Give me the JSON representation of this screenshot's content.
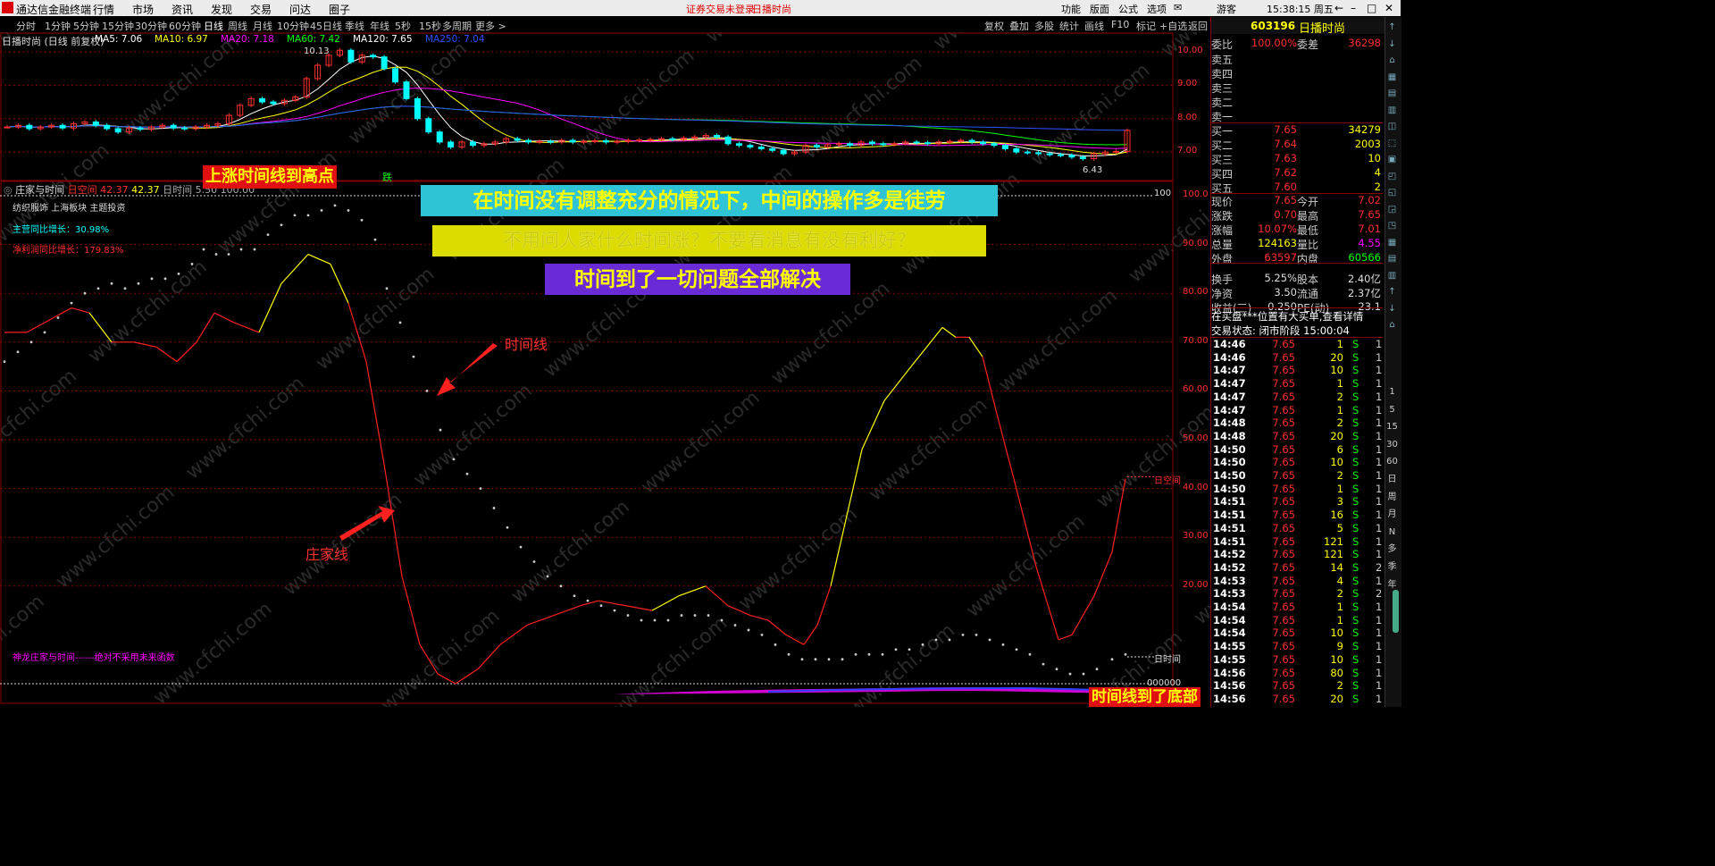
{
  "app": {
    "title": "通达信金融终端",
    "menu": [
      "行情",
      "市场",
      "资讯",
      "发现",
      "交易",
      "问达",
      "圈子"
    ],
    "status": "证券交易未登录",
    "stock_name_title": "日播时尚",
    "right_menu": [
      "功能",
      "版面",
      "公式",
      "选项"
    ],
    "user": "游客",
    "clock": "15:38:15 周五"
  },
  "periods": [
    "分时",
    "1分钟",
    "5分钟",
    "15分钟",
    "30分钟",
    "60分钟",
    "日线",
    "周线",
    "月线",
    "10分钟",
    "45日线",
    "季线",
    "年线",
    "5秒",
    "15秒",
    "多周期",
    "更多 >"
  ],
  "active_period": "日线",
  "toolbar_right": [
    "复权",
    "叠加",
    "多股",
    "统计",
    "画线",
    "F10",
    "标记",
    "+自选",
    "返回"
  ],
  "price_chart": {
    "header": "日播时尚 (日线 前复权)",
    "ma": [
      {
        "label": "MA5: 7.06",
        "color": "#ffffff"
      },
      {
        "label": "MA10: 6.97",
        "color": "#ffff00"
      },
      {
        "label": "MA20: 7.18",
        "color": "#ff00ff"
      },
      {
        "label": "MA60: 7.42",
        "color": "#00ff00"
      },
      {
        "label": "MA120: 7.65",
        "color": "#ffffff"
      },
      {
        "label": "MA250: 7.04",
        "color": "#3050ff"
      }
    ],
    "axis": [
      "10.00",
      "9.00",
      "8.00",
      "7.00"
    ],
    "high_label": "10.13",
    "low_label": "6.43",
    "down_mark": "跌"
  },
  "indicator": {
    "name": "庄家与时间",
    "v1_label": "日空间",
    "v1": "42.37",
    "v2": "42.37",
    "v3_label": "日时间",
    "v3": "5.50",
    "v4": "100.00",
    "info1": "纺织服饰 上海板块 主题投资",
    "info2": "主营同比增长：30.98%",
    "info3": "净利润同比增长：179.83%",
    "bottom_note": "神龙庄家与时间------绝对不采用未来函数",
    "axis": [
      "100.0",
      "90.00",
      "80.00",
      "70.00",
      "60.00",
      "50.00",
      "40.00",
      "30.00",
      "20.00"
    ],
    "right_tag1": "日空间",
    "right_tag2": "日时间",
    "zero_label": "000000",
    "top_label": "100"
  },
  "annotations": {
    "banner_up": "上涨时间线到高点",
    "banner1": "在时间没有调整充分的情况下，中间的操作多是徒劳",
    "banner2": "不用问人家什么时间涨？不要看消息有没有利好？",
    "banner3": "时间到了一切问题全部解决",
    "label_time_line": "时间线",
    "label_dealer_line": "庄家线",
    "banner_bottom": "时间线到了底部"
  },
  "quote": {
    "code": "603196",
    "name": "日播时尚",
    "weibi_label": "委比",
    "weibi": "100.00%",
    "weicha_label": "委差",
    "weicha": "36298",
    "sells": [
      "卖五",
      "卖四",
      "卖三",
      "卖二",
      "卖一"
    ],
    "buys": [
      {
        "label": "买一",
        "price": "7.65",
        "vol": "34279"
      },
      {
        "label": "买二",
        "price": "7.64",
        "vol": "2003"
      },
      {
        "label": "买三",
        "price": "7.63",
        "vol": "10"
      },
      {
        "label": "买四",
        "price": "7.62",
        "vol": "4"
      },
      {
        "label": "买五",
        "price": "7.60",
        "vol": "2"
      }
    ],
    "stats": [
      {
        "l1": "现价",
        "v1": "7.65",
        "c1": "#ff3030",
        "l2": "今开",
        "v2": "7.02",
        "c2": "#ff3030"
      },
      {
        "l1": "涨跌",
        "v1": "0.70",
        "c1": "#ff3030",
        "l2": "最高",
        "v2": "7.65",
        "c2": "#ff3030"
      },
      {
        "l1": "涨幅",
        "v1": "10.07%",
        "c1": "#ff3030",
        "l2": "最低",
        "v2": "7.01",
        "c2": "#ff3030"
      },
      {
        "l1": "总量",
        "v1": "124163",
        "c1": "#ffff00",
        "l2": "量比",
        "v2": "4.55",
        "c2": "#ff00ff"
      },
      {
        "l1": "外盘",
        "v1": "63597",
        "c1": "#ff3030",
        "l2": "内盘",
        "v2": "60566",
        "c2": "#00ff00"
      },
      {
        "l1": "换手",
        "v1": "5.25%",
        "c1": "#dddddd",
        "l2": "股本",
        "v2": "2.40亿",
        "c2": "#dddddd"
      },
      {
        "l1": "净资",
        "v1": "3.50",
        "c1": "#dddddd",
        "l2": "流通",
        "v2": "2.37亿",
        "c2": "#dddddd"
      },
      {
        "l1": "收益(三)",
        "v1": "0.250",
        "c1": "#dddddd",
        "l2": "PE(动)",
        "v2": "23.1",
        "c2": "#dddddd"
      }
    ],
    "notice": "在买盘***位置有大买单,查看详情",
    "trade_status": "交易状态: 闭市阶段 15:00:04",
    "ticks": [
      [
        "14:46",
        "7.65",
        "1",
        "S",
        "1"
      ],
      [
        "14:46",
        "7.65",
        "20",
        "S",
        "1"
      ],
      [
        "14:47",
        "7.65",
        "10",
        "S",
        "1"
      ],
      [
        "14:47",
        "7.65",
        "1",
        "S",
        "1"
      ],
      [
        "14:47",
        "7.65",
        "2",
        "S",
        "1"
      ],
      [
        "14:47",
        "7.65",
        "1",
        "S",
        "1"
      ],
      [
        "14:48",
        "7.65",
        "2",
        "S",
        "1"
      ],
      [
        "14:48",
        "7.65",
        "20",
        "S",
        "1"
      ],
      [
        "14:50",
        "7.65",
        "6",
        "S",
        "1"
      ],
      [
        "14:50",
        "7.65",
        "10",
        "S",
        "1"
      ],
      [
        "14:50",
        "7.65",
        "2",
        "S",
        "1"
      ],
      [
        "14:50",
        "7.65",
        "1",
        "S",
        "1"
      ],
      [
        "14:51",
        "7.65",
        "3",
        "S",
        "1"
      ],
      [
        "14:51",
        "7.65",
        "16",
        "S",
        "1"
      ],
      [
        "14:51",
        "7.65",
        "5",
        "S",
        "1"
      ],
      [
        "14:51",
        "7.65",
        "121",
        "S",
        "1"
      ],
      [
        "14:52",
        "7.65",
        "121",
        "S",
        "1"
      ],
      [
        "14:52",
        "7.65",
        "14",
        "S",
        "2"
      ],
      [
        "14:53",
        "7.65",
        "4",
        "S",
        "1"
      ],
      [
        "14:53",
        "7.65",
        "2",
        "S",
        "2"
      ],
      [
        "14:54",
        "7.65",
        "1",
        "S",
        "1"
      ],
      [
        "14:54",
        "7.65",
        "1",
        "S",
        "1"
      ],
      [
        "14:54",
        "7.65",
        "10",
        "S",
        "1"
      ],
      [
        "14:55",
        "7.65",
        "9",
        "S",
        "1"
      ],
      [
        "14:55",
        "7.65",
        "10",
        "S",
        "1"
      ],
      [
        "14:56",
        "7.65",
        "80",
        "S",
        "1"
      ],
      [
        "14:56",
        "7.65",
        "2",
        "S",
        "1"
      ],
      [
        "14:56",
        "7.65",
        "20",
        "S",
        "1"
      ]
    ]
  },
  "side_icons": [
    "1",
    "5",
    "15",
    "30",
    "60",
    "日",
    "周",
    "月",
    "N",
    "多",
    "季",
    "年"
  ]
}
